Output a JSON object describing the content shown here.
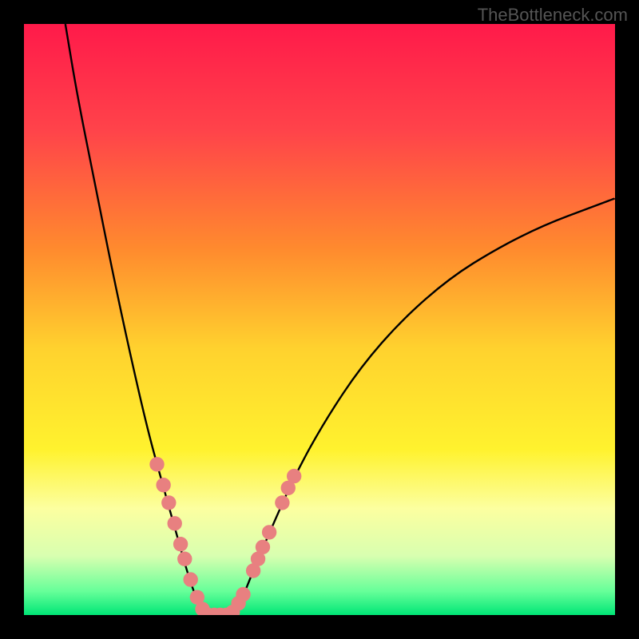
{
  "watermark": "TheBottleneck.com",
  "chart_data": {
    "type": "line",
    "title": "",
    "xlabel": "",
    "ylabel": "",
    "xlim": [
      0,
      100
    ],
    "ylim": [
      0,
      100
    ],
    "gradient_stops": [
      {
        "offset": 0,
        "color": "#ff1a4a"
      },
      {
        "offset": 18,
        "color": "#ff434a"
      },
      {
        "offset": 38,
        "color": "#ff8a2e"
      },
      {
        "offset": 55,
        "color": "#ffd22e"
      },
      {
        "offset": 72,
        "color": "#fff22e"
      },
      {
        "offset": 82,
        "color": "#fcffa0"
      },
      {
        "offset": 90,
        "color": "#d8ffb0"
      },
      {
        "offset": 96,
        "color": "#66ff99"
      },
      {
        "offset": 100,
        "color": "#00e676"
      }
    ],
    "series": [
      {
        "name": "left-branch",
        "type": "curve",
        "x": [
          7,
          9,
          12,
          15,
          18,
          21,
          23.5,
          26,
          28,
          29.5,
          30.5,
          31.2
        ],
        "y": [
          100,
          88,
          73,
          58,
          44,
          31,
          22,
          13,
          6,
          2,
          0.5,
          0
        ]
      },
      {
        "name": "right-branch",
        "type": "curve",
        "x": [
          34.5,
          35.5,
          37,
          39,
          42,
          46,
          51,
          57,
          64,
          72,
          80,
          88,
          96,
          100
        ],
        "y": [
          0,
          0.5,
          3,
          8,
          15,
          24,
          33,
          42,
          50,
          57,
          62,
          66,
          69,
          70.5
        ]
      },
      {
        "name": "bottom-flat",
        "type": "line",
        "x": [
          31.2,
          34.5
        ],
        "y": [
          0,
          0
        ]
      }
    ],
    "markers": [
      {
        "x": 22.5,
        "y": 25.5
      },
      {
        "x": 23.6,
        "y": 22
      },
      {
        "x": 24.5,
        "y": 19
      },
      {
        "x": 25.5,
        "y": 15.5
      },
      {
        "x": 26.5,
        "y": 12
      },
      {
        "x": 27.2,
        "y": 9.5
      },
      {
        "x": 28.2,
        "y": 6
      },
      {
        "x": 29.3,
        "y": 3
      },
      {
        "x": 30.2,
        "y": 1
      },
      {
        "x": 31.2,
        "y": 0
      },
      {
        "x": 32.2,
        "y": 0
      },
      {
        "x": 33.2,
        "y": 0
      },
      {
        "x": 34.2,
        "y": 0
      },
      {
        "x": 35.3,
        "y": 0.5
      },
      {
        "x": 36.3,
        "y": 2
      },
      {
        "x": 37.1,
        "y": 3.5
      },
      {
        "x": 38.8,
        "y": 7.5
      },
      {
        "x": 39.6,
        "y": 9.5
      },
      {
        "x": 40.4,
        "y": 11.5
      },
      {
        "x": 41.5,
        "y": 14
      },
      {
        "x": 43.7,
        "y": 19
      },
      {
        "x": 44.7,
        "y": 21.5
      },
      {
        "x": 45.7,
        "y": 23.5
      }
    ],
    "marker_color": "#e88080",
    "curve_color": "#000000"
  }
}
